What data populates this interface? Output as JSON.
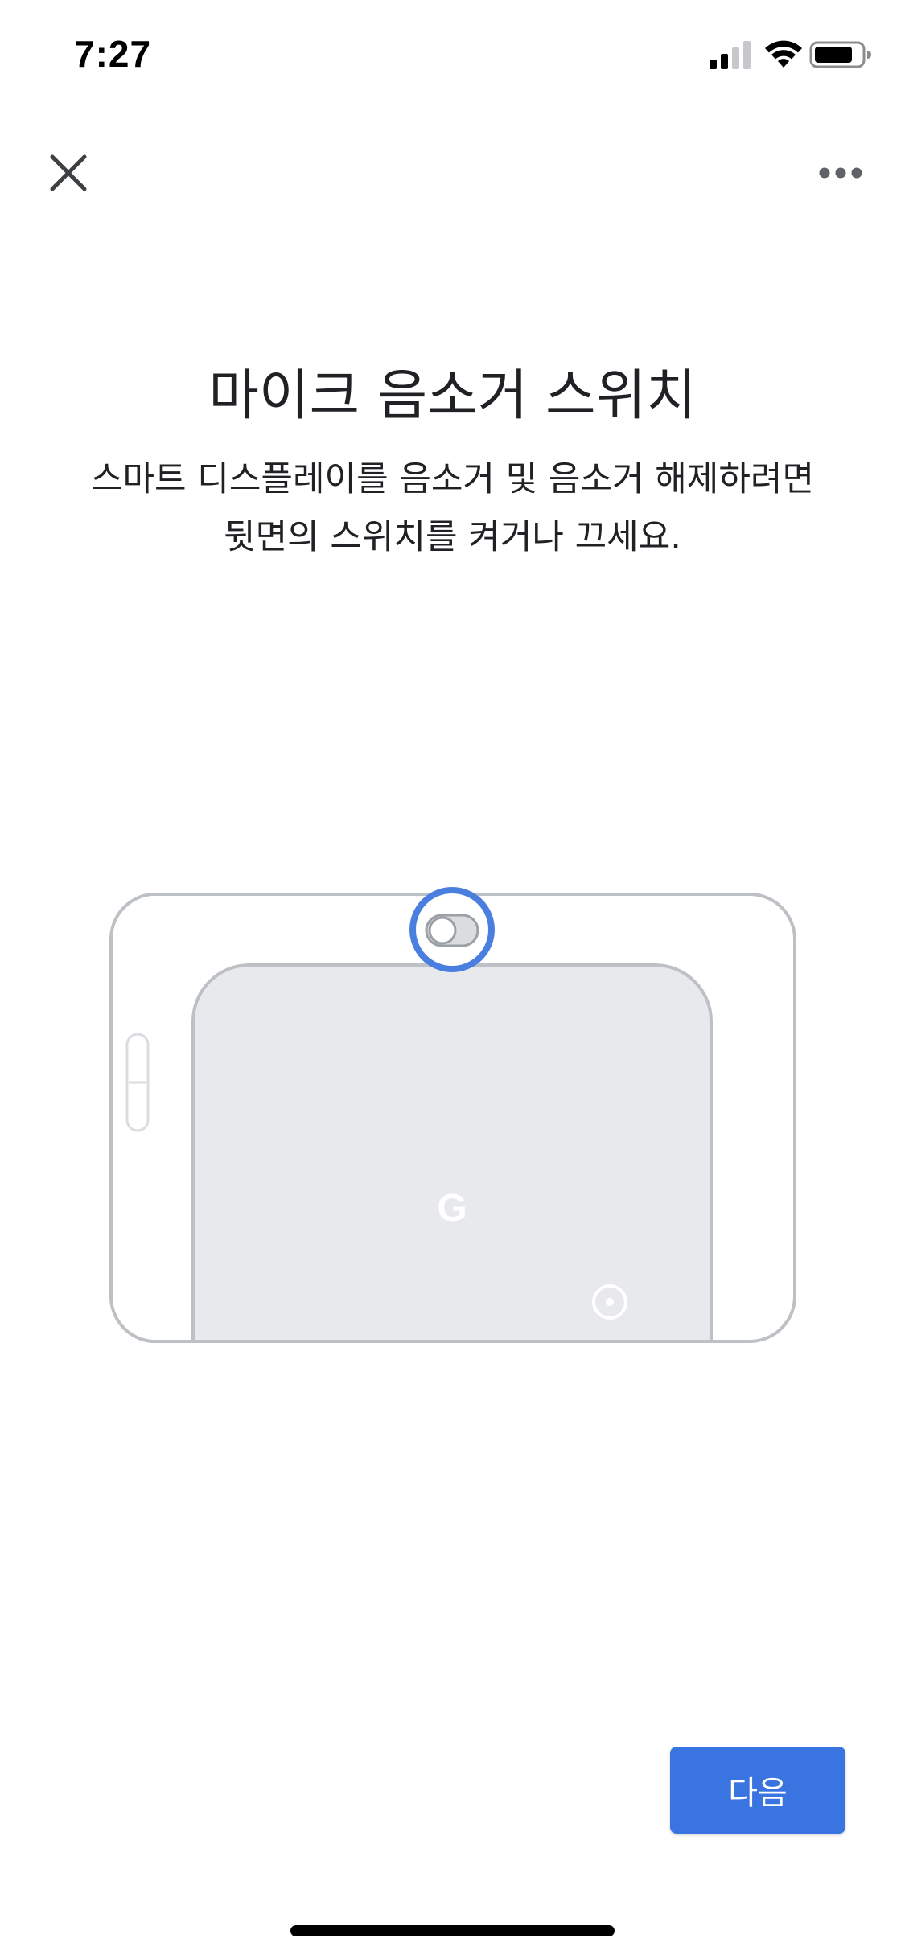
{
  "status_bar": {
    "time": "7:27",
    "icons": [
      "cellular-signal-icon",
      "wifi-icon",
      "battery-icon"
    ]
  },
  "app_bar": {
    "close_icon": "close-icon",
    "more_icon": "more-horizontal-icon"
  },
  "content": {
    "title": "마이크 음소거 스위치",
    "description_line1": "스마트 디스플레이를 음소거 및 음소거 해제하려면",
    "description_line2": "뒷면의 스위치를 켜거나 끄세요.",
    "illustration": {
      "logo_letter": "G",
      "highlight_color": "#4a7fe0",
      "device_color": "#e8e9ec",
      "outline_color": "#bdc0c5"
    }
  },
  "actions": {
    "next_label": "다음",
    "accent_color": "#3a74e0"
  }
}
